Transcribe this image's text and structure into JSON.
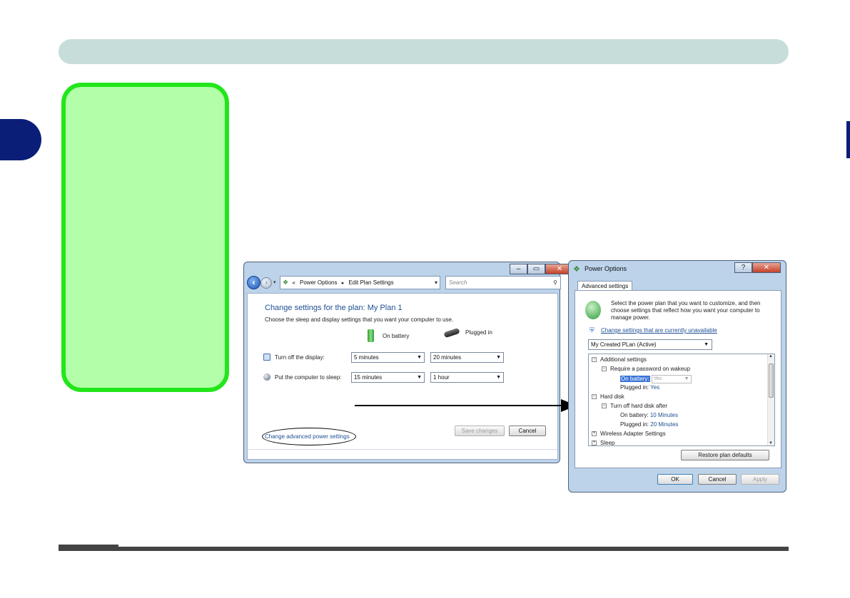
{
  "win1": {
    "address": {
      "prefix": "«",
      "crumb1": "Power Options",
      "crumb2": "Edit Plan Settings"
    },
    "search_placeholder": "Search",
    "plan_title": "Change settings for the plan: My Plan 1",
    "plan_desc": "Choose the sleep and display settings that you want your computer to use.",
    "col_battery": "On battery",
    "col_plugged": "Plugged in",
    "rows": [
      {
        "label": "Turn off the display:",
        "battery": "5 minutes",
        "plugged": "20 minutes"
      },
      {
        "label": "Put the computer to sleep:",
        "battery": "15 minutes",
        "plugged": "1 hour"
      }
    ],
    "adv_link": "Change advanced power settings",
    "save_label": "Save changes",
    "cancel_label": "Cancel"
  },
  "win2": {
    "title": "Power Options",
    "tab": "Advanced settings",
    "desc": "Select the power plan that you want to customize, and then choose settings that reflect how you want your computer to manage power.",
    "unavailable_link": "Change settings that are currently unavailable",
    "plan_select": "My Created PLan (Active)",
    "tree": {
      "additional": "Additional settings",
      "require_pw": "Require a password on wakeup",
      "on_battery_label": "On battery:",
      "on_battery_value": "Yes",
      "plugged_label": "Plugged in:",
      "plugged_value": "Yes",
      "hard_disk": "Hard disk",
      "turn_off_hd": "Turn off hard disk after",
      "hd_battery_label": "On battery:",
      "hd_battery_value": "10 Minutes",
      "hd_plugged_label": "Plugged in:",
      "hd_plugged_value": "20 Minutes",
      "wireless": "Wireless Adapter Settings",
      "sleep": "Sleep"
    },
    "restore_label": "Restore plan defaults",
    "ok_label": "OK",
    "cancel_label": "Cancel",
    "apply_label": "Apply"
  },
  "colors": {
    "top_bar": "#c7ddda",
    "chapter_tab": "#0a1e78",
    "note_fill": "#b3ffa9",
    "note_border": "#22e61b",
    "link": "#1d4f93"
  },
  "icons": {
    "back": "back-arrow-icon",
    "forward": "forward-arrow-icon",
    "refresh": "refresh-icon",
    "search": "search-icon",
    "battery": "battery-icon",
    "plug": "plug-icon",
    "monitor": "monitor-icon",
    "sleep": "moon-icon",
    "shield": "shield-icon"
  }
}
